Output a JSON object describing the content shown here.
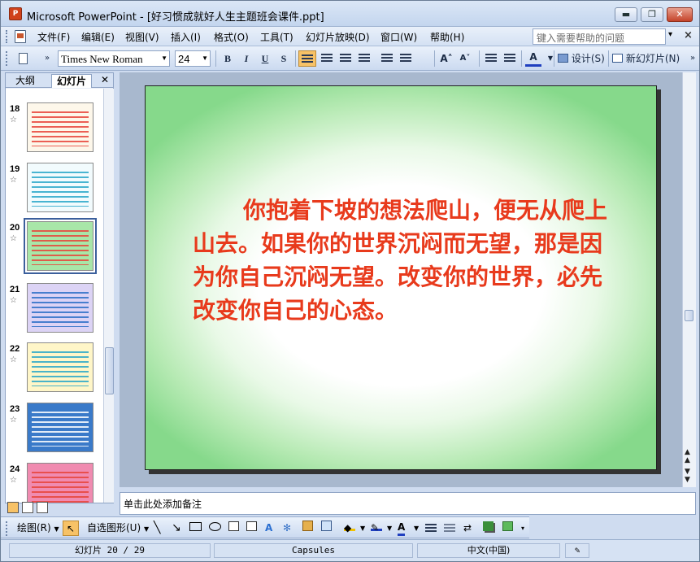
{
  "window": {
    "title": "Microsoft PowerPoint - [好习惯成就好人生主题班会课件.ppt]",
    "app_icon_text": "P",
    "buttons": {
      "minimize": "▬",
      "maximize": "❐",
      "close": "✕"
    }
  },
  "menu": {
    "items": [
      "文件(F)",
      "编辑(E)",
      "视图(V)",
      "插入(I)",
      "格式(O)",
      "工具(T)",
      "幻灯片放映(D)",
      "窗口(W)",
      "帮助(H)"
    ],
    "help_placeholder": "键入需要帮助的问题",
    "help_dropdown": "▾",
    "doc_close": "×"
  },
  "format_toolbar": {
    "font_name": "Times New Roman",
    "font_size": "24",
    "bold": "B",
    "italic": "I",
    "underline": "U",
    "shadow": "S",
    "increase_font": "A˄",
    "decrease_font": "A˅",
    "font_color": "A",
    "design_label": "设计(S)",
    "new_slide_label": "新幻灯片(N)",
    "more": "»",
    "active_alignment": "left"
  },
  "left_pane": {
    "tabs": [
      "大纲",
      "幻灯片"
    ],
    "close": "✕",
    "thumbnails": [
      {
        "number": "18",
        "color": "#e8443a",
        "bg": "#fdf7ea",
        "selected": false
      },
      {
        "number": "19",
        "color": "#2aa7c9",
        "bg": "#f2fbfd",
        "selected": false
      },
      {
        "number": "20",
        "color": "#e8443a",
        "bg": "#a8e6a8",
        "selected": true
      },
      {
        "number": "21",
        "color": "#2d6fc7",
        "bg": "#dcd3f5",
        "selected": false
      },
      {
        "number": "22",
        "color": "#2aa7c9",
        "bg": "#fff6c8",
        "selected": false
      },
      {
        "number": "23",
        "color": "#ffffff",
        "bg": "#3a7ac9",
        "selected": false
      },
      {
        "number": "24",
        "color": "#e8443a",
        "bg": "#f08bb0",
        "selected": false
      }
    ],
    "star": "☆"
  },
  "slide": {
    "text": "你抱着下坡的想法爬山，便无从爬上山去。如果你的世界沉闷而无望，那是因为你自己沉闷无望。改变你的世界，必先改变你自己的心态。",
    "text_color": "#e83a1c"
  },
  "notes": {
    "placeholder": "单击此处添加备注"
  },
  "draw_toolbar": {
    "draw_label": "绘图(R)",
    "autoshapes_label": "自选图形(U)"
  },
  "status_bar": {
    "slide_position": "幻灯片 20 / 29",
    "design_name": "Capsules",
    "language": "中文(中国)"
  }
}
